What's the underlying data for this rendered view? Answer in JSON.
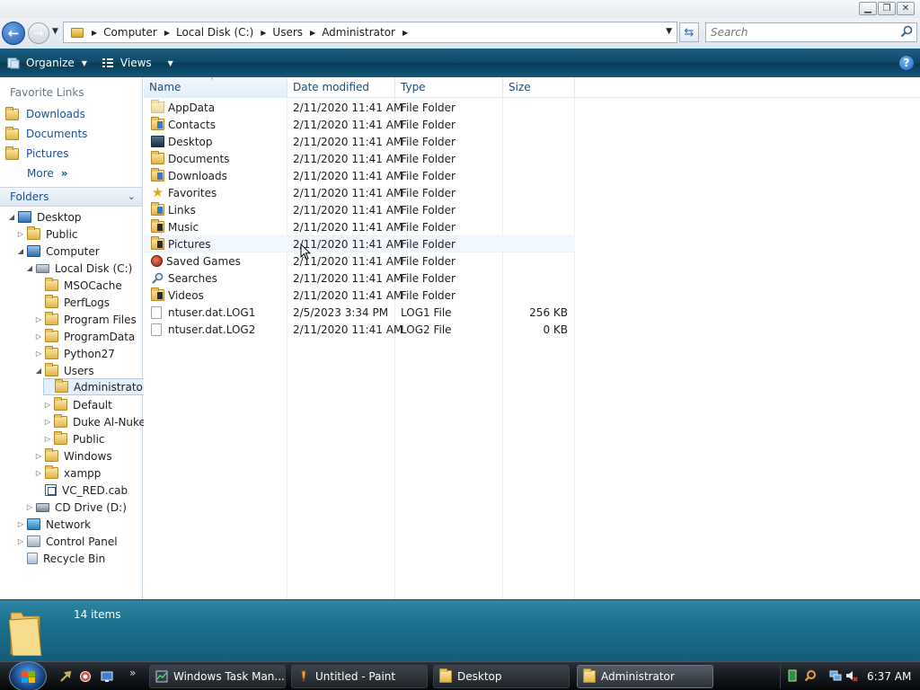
{
  "address": {
    "crumbs": [
      "Computer",
      "Local Disk (C:)",
      "Users",
      "Administrator"
    ]
  },
  "search": {
    "placeholder": "Search"
  },
  "commandbar": {
    "organize": "Organize",
    "views": "Views"
  },
  "favorites": {
    "title": "Favorite Links",
    "items": [
      "Downloads",
      "Documents",
      "Pictures"
    ],
    "more": "More"
  },
  "folders": {
    "title": "Folders",
    "tree": [
      {
        "label": "Desktop",
        "icon": "desktop-icon"
      },
      {
        "label": "Public",
        "icon": "folder-icon"
      },
      {
        "label": "Computer",
        "icon": "computer-icon"
      },
      {
        "label": "Local Disk (C:)",
        "icon": "hard-disk-icon"
      },
      {
        "label": "MSOCache",
        "icon": "folder-icon"
      },
      {
        "label": "PerfLogs",
        "icon": "folder-icon"
      },
      {
        "label": "Program Files",
        "icon": "folder-icon"
      },
      {
        "label": "ProgramData",
        "icon": "folder-icon"
      },
      {
        "label": "Python27",
        "icon": "folder-icon"
      },
      {
        "label": "Users",
        "icon": "folder-icon"
      },
      {
        "label": "Administrator",
        "icon": "folder-icon"
      },
      {
        "label": "Default",
        "icon": "folder-icon"
      },
      {
        "label": "Duke Al-Nuke",
        "icon": "folder-icon"
      },
      {
        "label": "Public",
        "icon": "folder-icon"
      },
      {
        "label": "Windows",
        "icon": "folder-icon"
      },
      {
        "label": "xampp",
        "icon": "folder-icon"
      },
      {
        "label": "VC_RED.cab",
        "icon": "cab-file-icon"
      },
      {
        "label": "CD Drive (D:)",
        "icon": "cd-drive-icon"
      },
      {
        "label": "Network",
        "icon": "network-icon"
      },
      {
        "label": "Control Panel",
        "icon": "control-panel-icon"
      },
      {
        "label": "Recycle Bin",
        "icon": "recycle-bin-icon"
      }
    ]
  },
  "columns": {
    "name": "Name",
    "date": "Date modified",
    "type": "Type",
    "size": "Size"
  },
  "files": [
    {
      "name": "AppData",
      "date": "2/11/2020 11:41 AM",
      "type": "File Folder",
      "size": "",
      "icon": "folder-icon"
    },
    {
      "name": "Contacts",
      "date": "2/11/2020 11:41 AM",
      "type": "File Folder",
      "size": "",
      "icon": "contacts-folder-icon"
    },
    {
      "name": "Desktop",
      "date": "2/11/2020 11:41 AM",
      "type": "File Folder",
      "size": "",
      "icon": "desktop-folder-icon"
    },
    {
      "name": "Documents",
      "date": "2/11/2020 11:41 AM",
      "type": "File Folder",
      "size": "",
      "icon": "documents-folder-icon"
    },
    {
      "name": "Downloads",
      "date": "2/11/2020 11:41 AM",
      "type": "File Folder",
      "size": "",
      "icon": "downloads-folder-icon"
    },
    {
      "name": "Favorites",
      "date": "2/11/2020 11:41 AM",
      "type": "File Folder",
      "size": "",
      "icon": "favorites-star-icon"
    },
    {
      "name": "Links",
      "date": "2/11/2020 11:41 AM",
      "type": "File Folder",
      "size": "",
      "icon": "links-folder-icon"
    },
    {
      "name": "Music",
      "date": "2/11/2020 11:41 AM",
      "type": "File Folder",
      "size": "",
      "icon": "music-folder-icon"
    },
    {
      "name": "Pictures",
      "date": "2/11/2020 11:41 AM",
      "type": "File Folder",
      "size": "",
      "icon": "pictures-folder-icon"
    },
    {
      "name": "Saved Games",
      "date": "2/11/2020 11:41 AM",
      "type": "File Folder",
      "size": "",
      "icon": "saved-games-icon"
    },
    {
      "name": "Searches",
      "date": "2/11/2020 11:41 AM",
      "type": "File Folder",
      "size": "",
      "icon": "searches-icon"
    },
    {
      "name": "Videos",
      "date": "2/11/2020 11:41 AM",
      "type": "File Folder",
      "size": "",
      "icon": "videos-folder-icon"
    },
    {
      "name": "ntuser.dat.LOG1",
      "date": "2/5/2023 3:34 PM",
      "type": "LOG1 File",
      "size": "256 KB",
      "icon": "file-icon"
    },
    {
      "name": "ntuser.dat.LOG2",
      "date": "2/11/2020 11:41 AM",
      "type": "LOG2 File",
      "size": "0 KB",
      "icon": "file-icon"
    }
  ],
  "details": {
    "count": "14 items"
  },
  "taskbar": {
    "tasks": [
      "Windows Task Man...",
      "Untitled - Paint",
      "Desktop",
      "Administrator"
    ],
    "clock": "6:37 AM"
  }
}
